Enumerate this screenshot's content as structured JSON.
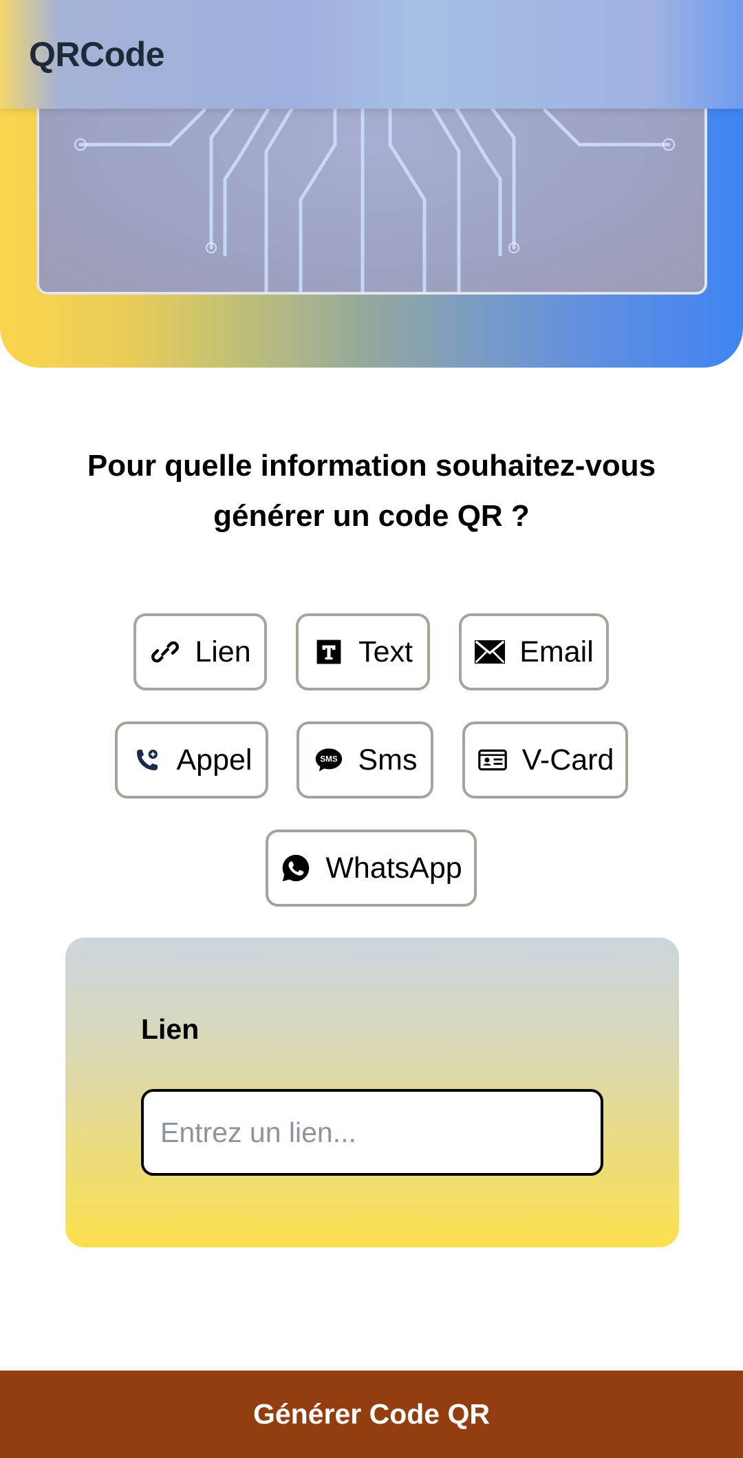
{
  "app": {
    "title": "QRCode"
  },
  "question": "Pour quelle information souhaitez-vous générer un code QR ?",
  "types": [
    {
      "label": "Lien",
      "icon": "link-icon"
    },
    {
      "label": "Text",
      "icon": "text-icon"
    },
    {
      "label": "Email",
      "icon": "envelope-icon"
    },
    {
      "label": "Appel",
      "icon": "phone-icon"
    },
    {
      "label": "Sms",
      "icon": "sms-icon"
    },
    {
      "label": "V-Card",
      "icon": "id-card-icon"
    },
    {
      "label": "WhatsApp",
      "icon": "whatsapp-icon"
    }
  ],
  "form": {
    "label": "Lien",
    "placeholder": "Entrez un lien...",
    "value": ""
  },
  "generate_label": "Générer Code QR",
  "colors": {
    "accent_brown": "#923e10",
    "hero_yellow": "#fbd54c",
    "hero_blue": "#3f85f2"
  }
}
